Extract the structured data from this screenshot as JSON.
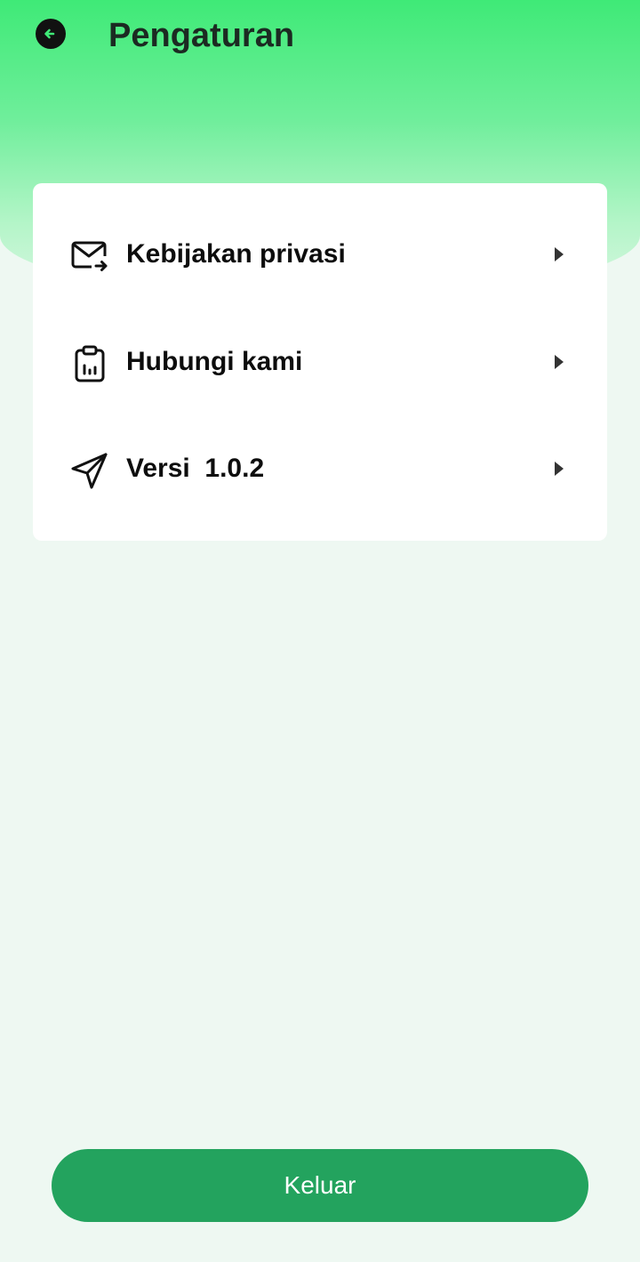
{
  "header": {
    "title": "Pengaturan",
    "back_icon": "arrow-left-circle-icon"
  },
  "settings": {
    "items": [
      {
        "label": "Kebijakan privasi",
        "icon": "mail-forward-icon",
        "chevron": "caret-right-icon"
      },
      {
        "label": "Hubungi kami",
        "icon": "clipboard-chart-icon",
        "chevron": "caret-right-icon"
      },
      {
        "label": "Versi  1.0.2",
        "icon": "send-icon",
        "chevron": "caret-right-icon"
      }
    ]
  },
  "footer": {
    "logout_label": "Keluar"
  },
  "colors": {
    "accent_green": "#3fea77",
    "button_green": "#23a35e",
    "background": "#eef8f2",
    "card": "#ffffff"
  }
}
